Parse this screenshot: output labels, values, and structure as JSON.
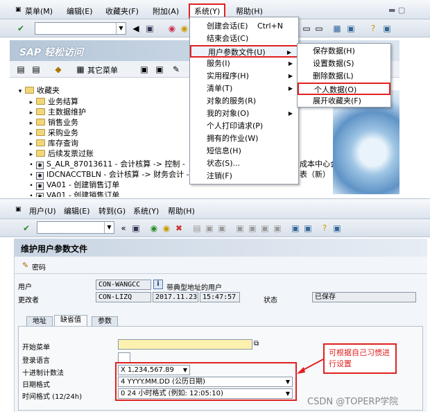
{
  "top_window": {
    "menu": [
      "菜单(M)",
      "编辑(E)",
      "收藏夹(F)",
      "附加(A)",
      "系统(Y)",
      "帮助(H)"
    ],
    "banner_title": "SAP 轻松访问",
    "toolbar2_label": "其它菜单",
    "tree": {
      "root": "收藏夹",
      "folders": [
        "业务结算",
        "主数据维护",
        "销售业务",
        "采购业务",
        "库存查询",
        "后续发票过账"
      ],
      "transactions": [
        "S_ALR_87013611 - 会计核算 -> 控制 - ",
        "IDCNACCTBLN - 会计核算 -> 财务会计 - ",
        "VA01 - 创建销售订单",
        "VA01 - 创建销售订单"
      ],
      "behind_1": "成本中心会计的",
      "behind_2": "表（新） -> 科目"
    }
  },
  "system_menu": {
    "items": [
      {
        "label": "创建会话(E)",
        "shortcut": "Ctrl+N",
        "arrow": false
      },
      {
        "label": "结束会话(C)",
        "shortcut": "",
        "arrow": false
      },
      {
        "label": "用户参数文件(U)",
        "shortcut": "",
        "arrow": true
      },
      {
        "label": "服务(I)",
        "shortcut": "",
        "arrow": true
      },
      {
        "label": "实用程序(H)",
        "shortcut": "",
        "arrow": true
      },
      {
        "label": "清单(T)",
        "shortcut": "",
        "arrow": true
      },
      {
        "label": "对象的服务(R)",
        "shortcut": "",
        "arrow": false
      },
      {
        "label": "我的对象(O)",
        "shortcut": "",
        "arrow": true
      },
      {
        "label": "个人打印请求(P)",
        "shortcut": "",
        "arrow": false
      },
      {
        "label": "拥有的作业(W)",
        "shortcut": "",
        "arrow": false
      },
      {
        "label": "短信息(H)",
        "shortcut": "",
        "arrow": false
      },
      {
        "label": "状态(S)...",
        "shortcut": "",
        "arrow": false
      },
      {
        "label": "注销(F)",
        "shortcut": "",
        "arrow": false
      }
    ]
  },
  "submenu": {
    "items": [
      "保存数据(H)",
      "设置数据(S)",
      "删除数据(L)",
      "个人数据(O)",
      "展开收藏夹(F)"
    ]
  },
  "bottom_window": {
    "menu": [
      "用户(U)",
      "编辑(E)",
      "转到(G)",
      "系统(Y)",
      "帮助(H)"
    ],
    "title": "维护用户参数文件",
    "password_label": "密码",
    "user_label": "用户",
    "user_value": "CON-WANGCC",
    "user_desc": "带典型地址的用户",
    "changed_by_label": "更改者",
    "changed_by_value": "CON-LIZQ",
    "date_value": "2017.11.23",
    "time_value": "15:47:57",
    "status_label": "状态",
    "status_value": "已保存",
    "tabs": [
      "地址",
      "缺省值",
      "参数"
    ],
    "form": {
      "start_menu_label": "开始菜单",
      "login_lang_label": "登录语言",
      "decimal_label": "十进制计数法",
      "decimal_value": "X 1,234,567.89",
      "date_format_label": "日期格式",
      "date_format_value": "4 YYYY.MM.DD (公历日期)",
      "time_format_label": "时间格式 (12/24h)",
      "time_format_value": "0 24 小时格式 (例如: 12:05:10)"
    },
    "annotation": "可根据自己习惯进行设置"
  },
  "watermark": "CSDN @TOPERP学院",
  "colors": {
    "highlight_red": "#e02020",
    "menu_bg": "#dde4ee",
    "field_yellow": "#fdf1b0"
  }
}
